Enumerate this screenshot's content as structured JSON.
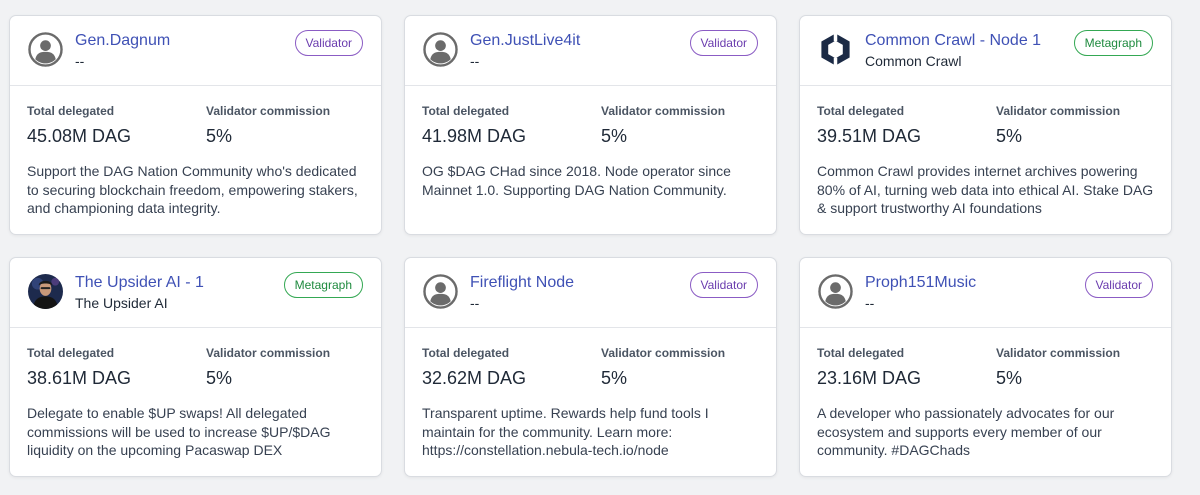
{
  "labels": {
    "total_delegated": "Total delegated",
    "validator_commission": "Validator commission"
  },
  "colors": {
    "name_link": "#3f51b5",
    "validator_badge": "#6a3cae",
    "metagraph_badge": "#1e8a3e",
    "background": "#f1f2f4"
  },
  "cards": [
    {
      "name": "Gen.Dagnum",
      "subtitle": "--",
      "badge": "Validator",
      "avatar_icon": "default-user-icon",
      "total_delegated": "45.08M DAG",
      "commission": "5%",
      "description": "Support the DAG Nation Community who's dedicated to securing blockchain freedom, empowering stakers, and championing data integrity."
    },
    {
      "name": "Gen.JustLive4it",
      "subtitle": "--",
      "badge": "Validator",
      "avatar_icon": "default-user-icon",
      "total_delegated": "41.98M DAG",
      "commission": "5%",
      "description": "OG $DAG CHad since 2018. Node operator since Mainnet 1.0. Supporting DAG Nation Community."
    },
    {
      "name": "Common Crawl - Node 1",
      "subtitle": "Common Crawl",
      "badge": "Metagraph",
      "avatar_icon": "common-crawl-logo",
      "total_delegated": "39.51M DAG",
      "commission": "5%",
      "description": "Common Crawl provides internet archives powering 80% of AI, turning web data into ethical AI. Stake DAG & support trustworthy AI foundations"
    },
    {
      "name": "The Upsider AI - 1",
      "subtitle": "The Upsider AI",
      "badge": "Metagraph",
      "avatar_icon": "upsider-avatar",
      "total_delegated": "38.61M DAG",
      "commission": "5%",
      "description": "Delegate to enable $UP swaps! All delegated commissions will be used to increase $UP/$DAG liquidity on the upcoming Pacaswap DEX"
    },
    {
      "name": "Fireflight Node",
      "subtitle": "--",
      "badge": "Validator",
      "avatar_icon": "default-user-icon",
      "total_delegated": "32.62M DAG",
      "commission": "5%",
      "description": "Transparent uptime. Rewards help fund tools I maintain for the community. Learn more: https://constellation.nebula-tech.io/node"
    },
    {
      "name": "Proph151Music",
      "subtitle": "--",
      "badge": "Validator",
      "avatar_icon": "default-user-icon",
      "total_delegated": "23.16M DAG",
      "commission": "5%",
      "description": "A developer who passionately advocates for our ecosystem and supports every member of our community. #DAGChads"
    }
  ]
}
